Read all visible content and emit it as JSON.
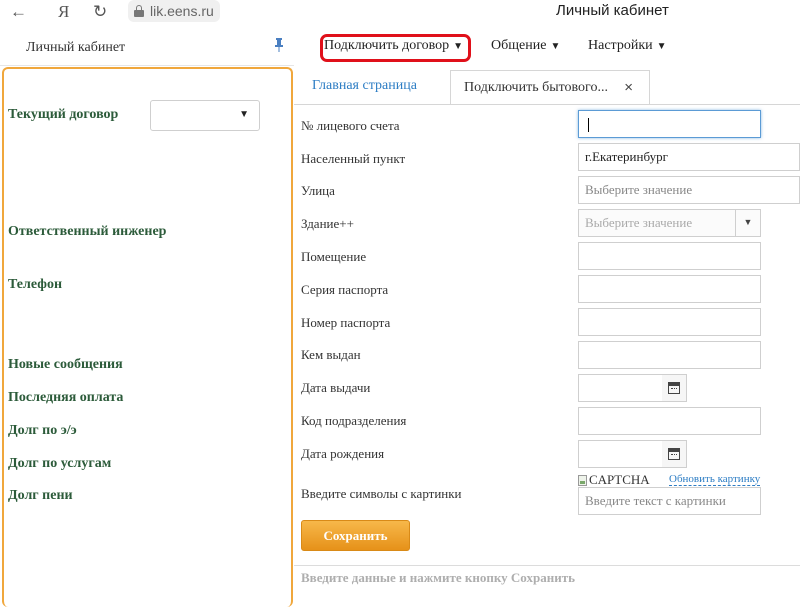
{
  "browser": {
    "back_glyph": "←",
    "ya_glyph": "Я",
    "reload_glyph": "↻",
    "url": "lik.eens.ru",
    "window_title": "Личный кабинет"
  },
  "header": {
    "title": "Личный кабинет",
    "pin_glyph": "✎",
    "menu": {
      "connect": "Подключить договор",
      "chat": "Общение",
      "settings": "Настройки",
      "caret": "▼"
    }
  },
  "sidebar": {
    "current_contract": "Текущий договор",
    "contract_caret": "▼",
    "engineer": "Ответственный инженер",
    "phone": "Телефон",
    "new_messages": "Новые сообщения",
    "last_payment": "Последняя оплата",
    "debt_ee": "Долг по э/э",
    "debt_services": "Долг по услугам",
    "debt_penalty": "Долг пени"
  },
  "tabs": {
    "main": "Главная страница",
    "connect": "Подключить бытового...",
    "close_glyph": "×"
  },
  "form": {
    "account_label": "№ лицевого счета",
    "account_value": "",
    "locality_label": "Населенный пункт",
    "locality_value": "г.Екатеринбург",
    "street_label": "Улица",
    "street_placeholder": "Выберите значение",
    "building_label": "Здание++",
    "building_placeholder": "Выберите значение",
    "building_caret": "▼",
    "room_label": "Помещение",
    "passport_series_label": "Серия паспорта",
    "passport_number_label": "Номер паспорта",
    "issued_by_label": "Кем выдан",
    "issue_date_label": "Дата выдачи",
    "division_code_label": "Код подразделения",
    "birth_date_label": "Дата рождения",
    "captcha_label": "Введите символы с картинки",
    "captcha_alt": "CAPTCHA",
    "captcha_refresh": "Обновить картинку",
    "captcha_placeholder": "Введите текст с картинки",
    "save": "Сохранить",
    "hint": "Введите данные и нажмите кнопку Сохранить"
  },
  "colors": {
    "accent_orange": "#f0a73c",
    "highlight_red": "#e0101a",
    "link_blue": "#2d7dc4",
    "sidebar_green": "#2c5b3a"
  }
}
